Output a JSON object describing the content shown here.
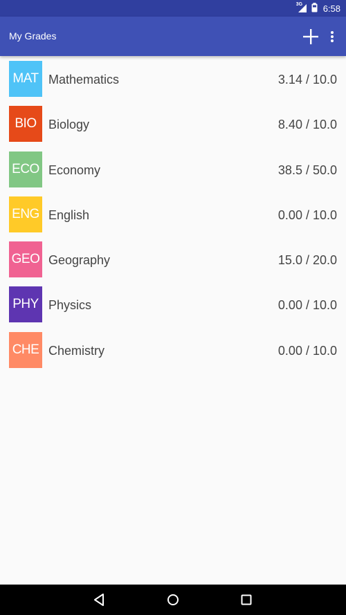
{
  "status_bar": {
    "network_type": "3G",
    "time": "6:58",
    "icons": [
      "signal-icon",
      "battery-icon"
    ]
  },
  "app_bar": {
    "title": "My Grades",
    "actions": [
      "plus-icon",
      "overflow-menu-icon"
    ]
  },
  "subjects": [
    {
      "abbr": "MAT",
      "name": "Mathematics",
      "grade": "3.14 / 10.0",
      "color": "#4FC3F7"
    },
    {
      "abbr": "BIO",
      "name": "Biology",
      "grade": "8.40 / 10.0",
      "color": "#E64A19"
    },
    {
      "abbr": "ECO",
      "name": "Economy",
      "grade": "38.5 / 50.0",
      "color": "#81C784"
    },
    {
      "abbr": "ENG",
      "name": "English",
      "grade": "0.00 / 10.0",
      "color": "#FFCA28"
    },
    {
      "abbr": "GEO",
      "name": "Geography",
      "grade": "15.0 / 20.0",
      "color": "#F06292"
    },
    {
      "abbr": "PHY",
      "name": "Physics",
      "grade": "0.00 / 10.0",
      "color": "#5E35B1"
    },
    {
      "abbr": "CHE",
      "name": "Chemistry",
      "grade": "0.00 / 10.0",
      "color": "#FF8A65"
    }
  ],
  "nav_bar": {
    "buttons": [
      "back-icon",
      "home-icon",
      "recents-icon"
    ]
  },
  "colors": {
    "status_bar": "#303F9F",
    "app_bar": "#3F51B5",
    "background": "#FAFAFA",
    "nav_bar": "#000000"
  }
}
